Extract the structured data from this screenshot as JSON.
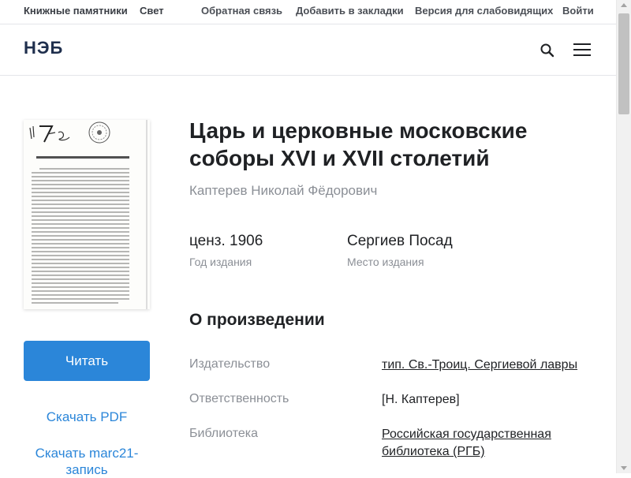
{
  "topbar": {
    "links": [
      "Книжные памятники",
      "Свет",
      "Обратная связь",
      "Добавить в закладки",
      "Версия для слабовидящих",
      "Войти"
    ]
  },
  "header": {
    "logo": "НЭБ",
    "search_icon": "search-icon",
    "menu_icon": "hamburger-menu-icon"
  },
  "book": {
    "title": "Царь и церковные московские соборы XVI и XVII столетий",
    "author": "Каптерев Николай Фёдорович",
    "year_value": "ценз. 1906",
    "year_label": "Год издания",
    "place_value": "Сергиев Посад",
    "place_label": "Место издания"
  },
  "cover": {
    "heading": "Царь и церковные московские соборы XVI и XVII столетій."
  },
  "actions": {
    "read_label": "Читать",
    "download_pdf_label": "Скачать PDF",
    "download_marc_label": "Скачать marc21-запись"
  },
  "about": {
    "title": "О произведении",
    "rows": [
      {
        "label": "Издательство",
        "value": "тип. Св.-Троиц. Сергиевой лавры"
      },
      {
        "label": "Ответственность",
        "value": "[Н. Каптерев]"
      },
      {
        "label": "Библиотека",
        "value": "Российская государственная библиотека (РГБ)"
      }
    ]
  },
  "colors": {
    "accent": "#2b86d9",
    "text": "#1f2124",
    "muted": "#8b8f96"
  }
}
